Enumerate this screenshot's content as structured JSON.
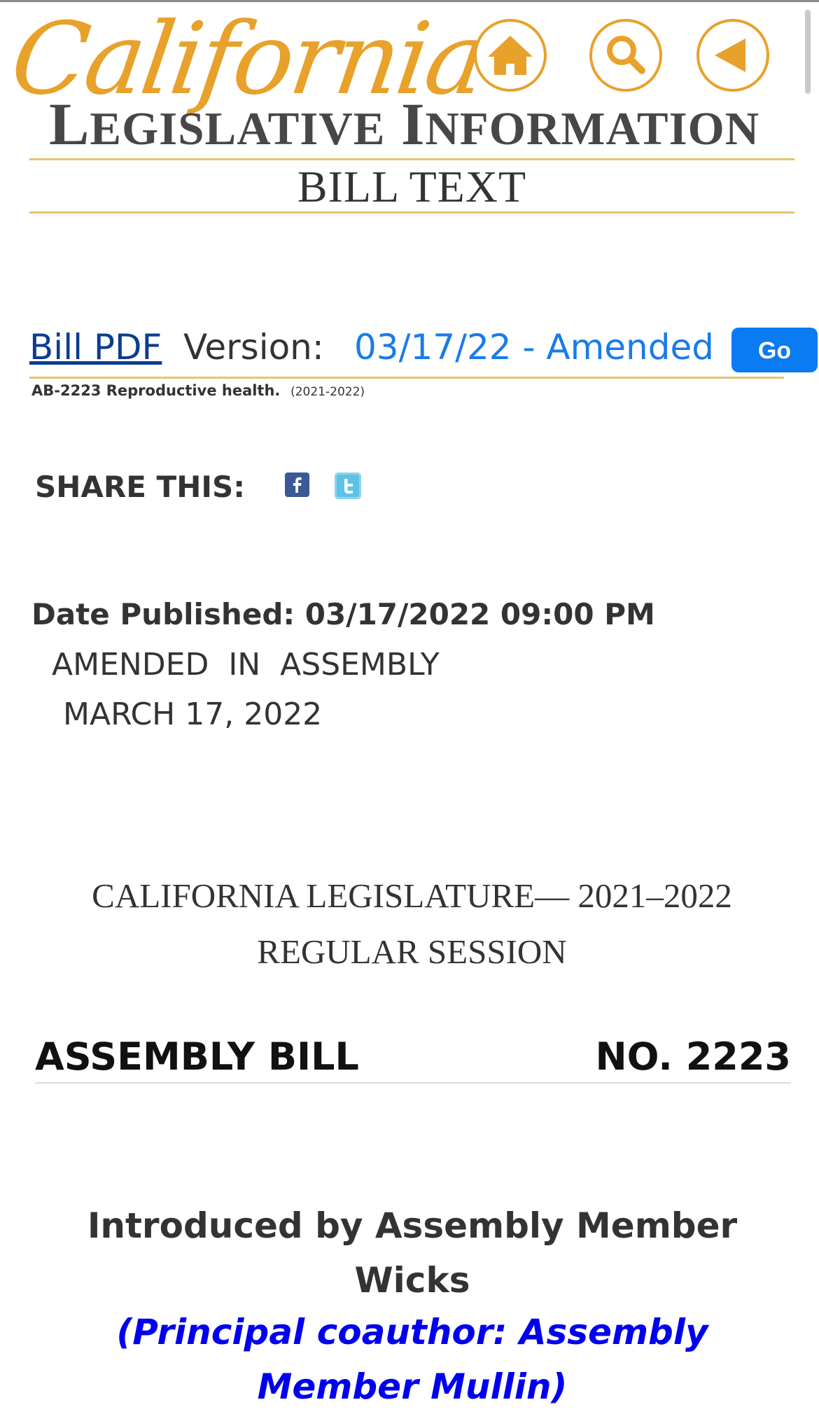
{
  "header": {
    "brand_script": "California",
    "brand_sub_L": "L",
    "brand_sub_egislative": "EGISLATIVE",
    "brand_sub_I": "I",
    "brand_sub_nformation": "NFORMATION",
    "section_title": "BILL TEXT",
    "nav": {
      "home_icon": "home-icon",
      "search_icon": "search-icon",
      "back_icon": "back-arrow-icon"
    },
    "accent_color": "#E8A12A"
  },
  "version_bar": {
    "pdf_link": "Bill PDF",
    "version_label": "Version:",
    "selected_version": "03/17/22 - Amended",
    "go_label": "Go"
  },
  "bill": {
    "title": "AB-2223 Reproductive health.",
    "session": "(2021-2022)"
  },
  "share": {
    "label": "SHARE THIS:",
    "facebook_icon": "facebook-icon",
    "twitter_icon": "twitter-icon"
  },
  "status": {
    "date_published": "Date Published: 03/17/2022 09:00 PM",
    "amended_line1": "AMENDED  IN  ASSEMBLY",
    "amended_line2": "MARCH 17, 2022"
  },
  "document": {
    "legislature_line1": "CALIFORNIA LEGISLATURE— 2021–2022",
    "legislature_line2": "REGULAR SESSION",
    "bill_label": "ASSEMBLY BILL",
    "bill_number": "NO. 2223",
    "introduced_line1": "Introduced by Assembly Member",
    "introduced_line2": "Wicks",
    "coauthor_line1": "(Principal coauthor: Assembly",
    "coauthor_line2": "Member Mullin)"
  }
}
